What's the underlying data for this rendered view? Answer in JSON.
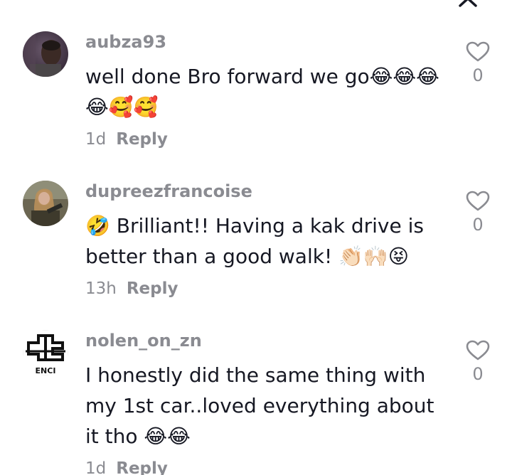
{
  "comments": [
    {
      "username": "aubza93",
      "text": "well done Bro forward we go😂😂😂 😂🥰🥰",
      "time": "1d",
      "reply": "Reply",
      "likes": "0"
    },
    {
      "username": "dupreezfrancoise",
      "text": "🤣 Brilliant!! Having a kak drive is better than a good walk! 👏🏻🙌🏻😝",
      "time": "13h",
      "reply": "Reply",
      "likes": "0"
    },
    {
      "username": "nolen_on_zn",
      "text": "I honestly did the same thing with my 1st car..loved everything about it tho 😂😂",
      "time": "1d",
      "reply": "Reply",
      "likes": "0"
    }
  ],
  "avatar3_text": "ENCI",
  "colors": {
    "username": "#8a8b91",
    "text": "#161823",
    "icon": "#8a8b91"
  },
  "icons": {
    "close": "close-icon",
    "like": "heart-outline-icon"
  }
}
